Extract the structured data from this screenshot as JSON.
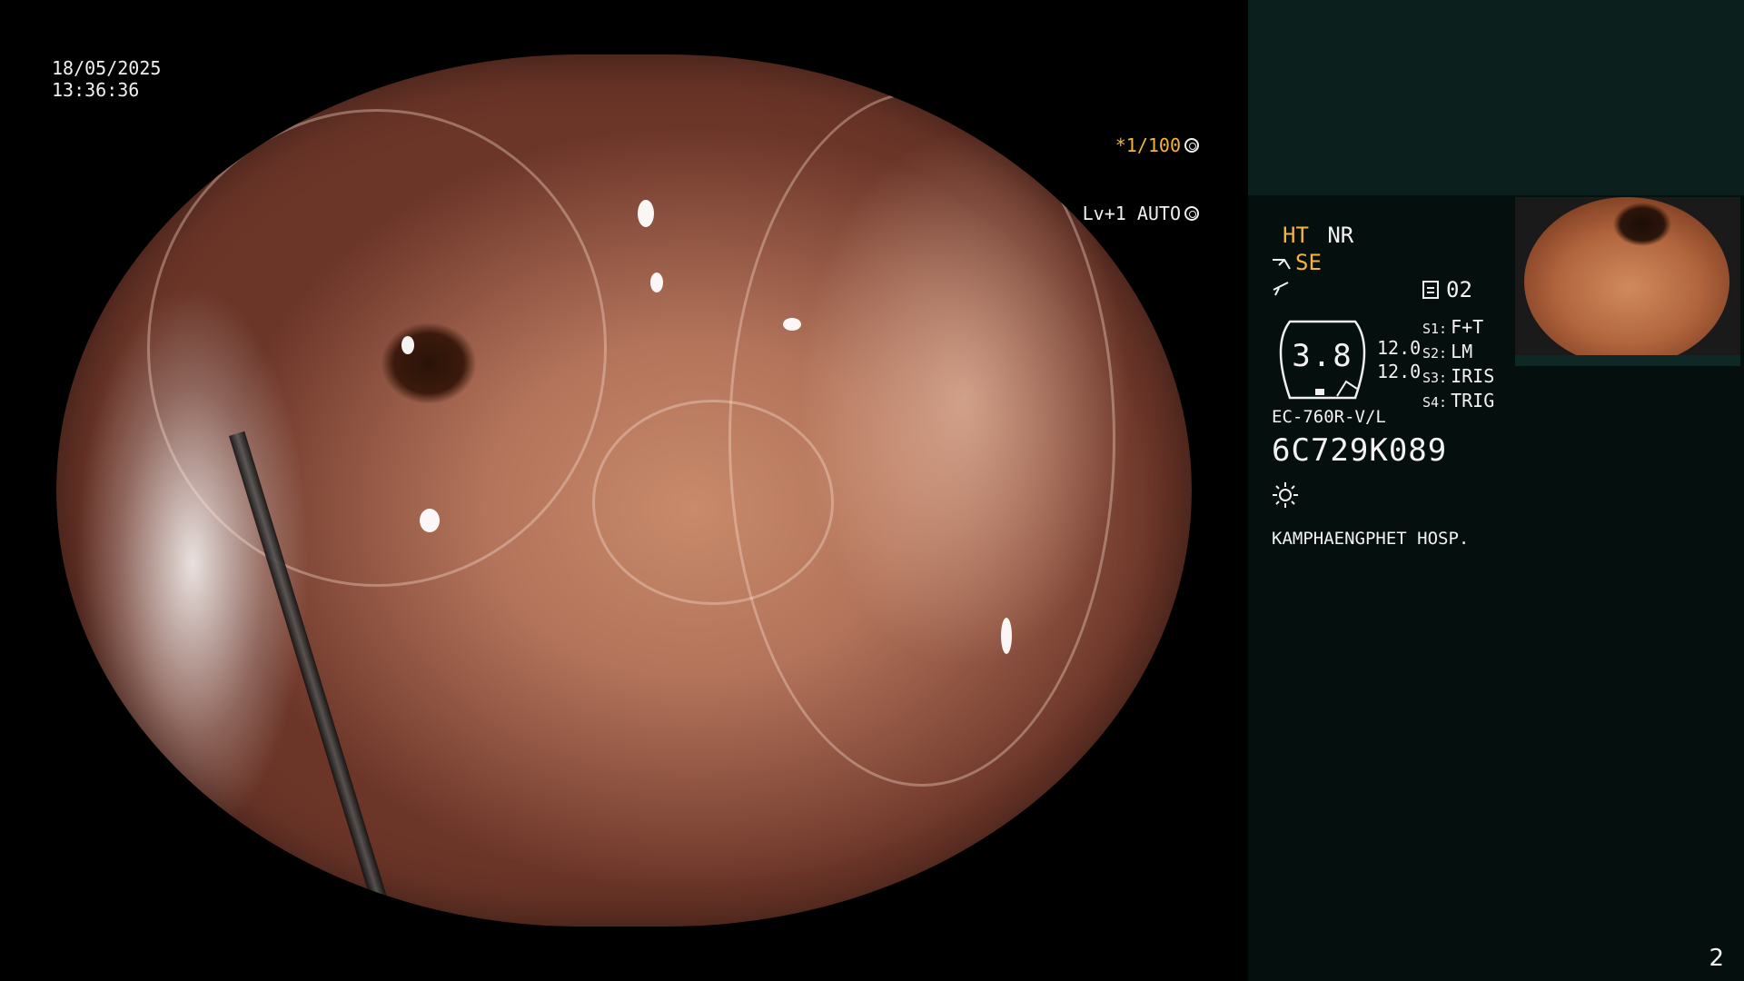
{
  "overlay": {
    "date": "18/05/2025",
    "time": "13:36:36",
    "shutter": "*1/100",
    "exposure": "Lv+1 AUTO"
  },
  "panel": {
    "mode_ht": "HT",
    "mode_nr": "NR",
    "mode_se": "SE",
    "memory": "02",
    "gauge_value": "3.8",
    "gauge_side": [
      "12.0",
      "12.0"
    ],
    "switches": [
      {
        "key": "S1:",
        "value": "F+T"
      },
      {
        "key": "S2:",
        "value": "LM"
      },
      {
        "key": "S3:",
        "value": "IRIS"
      },
      {
        "key": "S4:",
        "value": "TRIG"
      }
    ],
    "scope_model": "EC-760R-V/L",
    "scope_serial": "6C729K089",
    "hospital": "KAMPHAENGPHET HOSP."
  },
  "page_number": "2",
  "colors": {
    "accent_amber": "#f4b63a",
    "panel_bg": "#050f0d",
    "panel_top_bg": "#0b1f1d"
  },
  "icons": [
    "shutter-wheel-icon",
    "iris-icon",
    "scope-tip-icon",
    "flash-icon",
    "memory-card-icon",
    "sun-icon"
  ]
}
